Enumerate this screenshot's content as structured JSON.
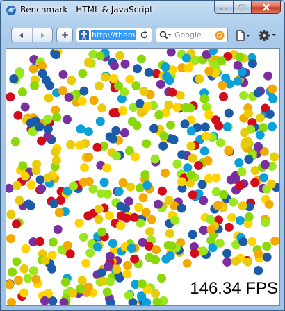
{
  "window": {
    "title": "Benchmark - HTML & JavaScript"
  },
  "toolbar": {
    "url": "http://them",
    "search_placeholder": "Google"
  },
  "content": {
    "fps_label": "146.34 FPS",
    "dot_colors": [
      "#e9cb0a",
      "#ffd400",
      "#f2a900",
      "#0aa0d8",
      "#1c5ba8",
      "#7a2fa0",
      "#d30c1b",
      "#9be61f",
      "#8ad80a"
    ]
  },
  "colors": {
    "url_highlight": "#3399ff",
    "close_button": "#c7371c"
  }
}
